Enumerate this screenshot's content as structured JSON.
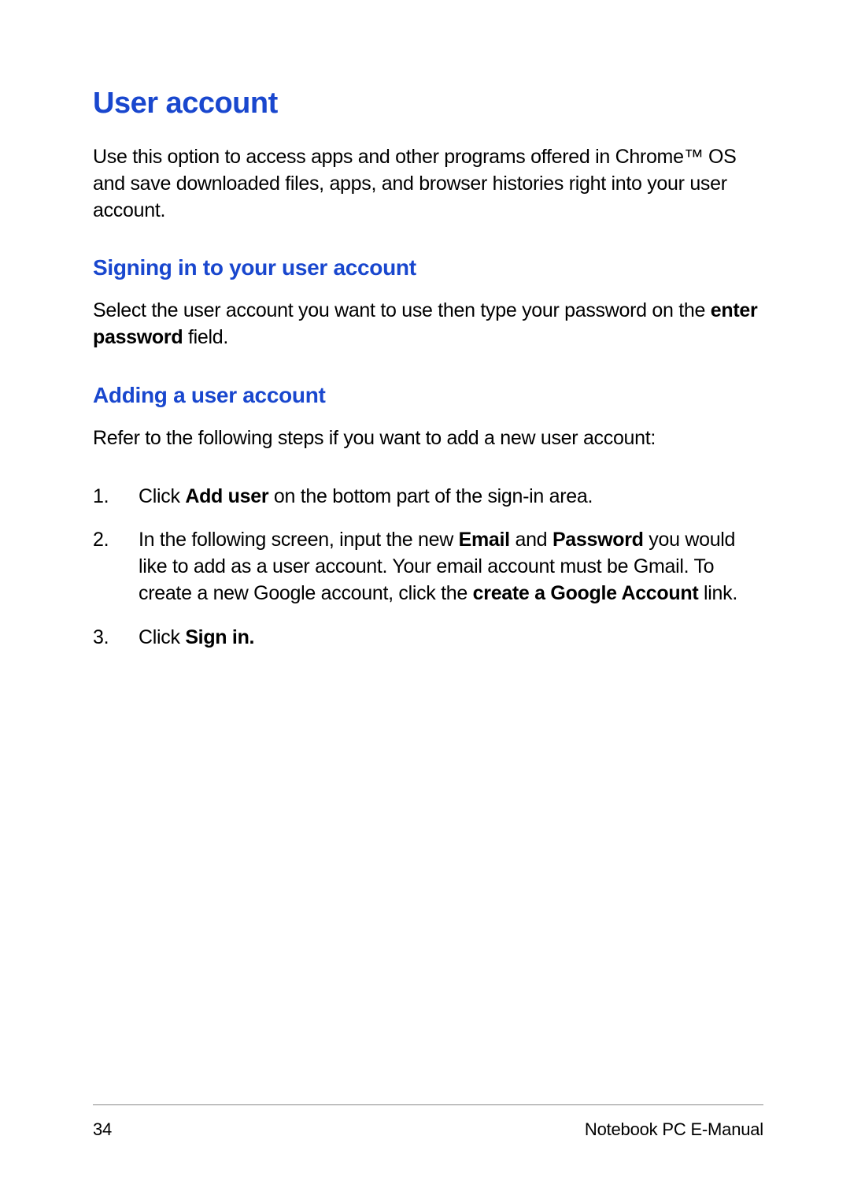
{
  "heading": "User account",
  "intro_text": "Use this option to access apps and other programs offered in Chrome™ OS and save downloaded files, apps, and browser histories right into your user account.",
  "section1": {
    "heading": "Signing in to your user account",
    "text_prefix": "Select the user account you want to use then type your password on the ",
    "text_bold": "enter password",
    "text_suffix": " field."
  },
  "section2": {
    "heading": "Adding a user account",
    "intro": "Refer to the following steps if you want to add a new user account:",
    "steps": [
      {
        "num": "1.",
        "parts": [
          {
            "text": "Click ",
            "bold": false
          },
          {
            "text": "Add user",
            "bold": true
          },
          {
            "text": " on the bottom part of the sign-in area.",
            "bold": false
          }
        ]
      },
      {
        "num": "2.",
        "parts": [
          {
            "text": "In the following screen, input the new ",
            "bold": false
          },
          {
            "text": "Email",
            "bold": true
          },
          {
            "text": " and ",
            "bold": false
          },
          {
            "text": "Password",
            "bold": true
          },
          {
            "text": " you would like to add as a user account. Your email account must be Gmail. To create a new Google account, click the ",
            "bold": false
          },
          {
            "text": "create a Google Account",
            "bold": true
          },
          {
            "text": " link.",
            "bold": false
          }
        ]
      },
      {
        "num": "3.",
        "parts": [
          {
            "text": "Click ",
            "bold": false
          },
          {
            "text": "Sign in.",
            "bold": true
          }
        ]
      }
    ]
  },
  "footer": {
    "page_number": "34",
    "title": "Notebook PC E-Manual"
  }
}
